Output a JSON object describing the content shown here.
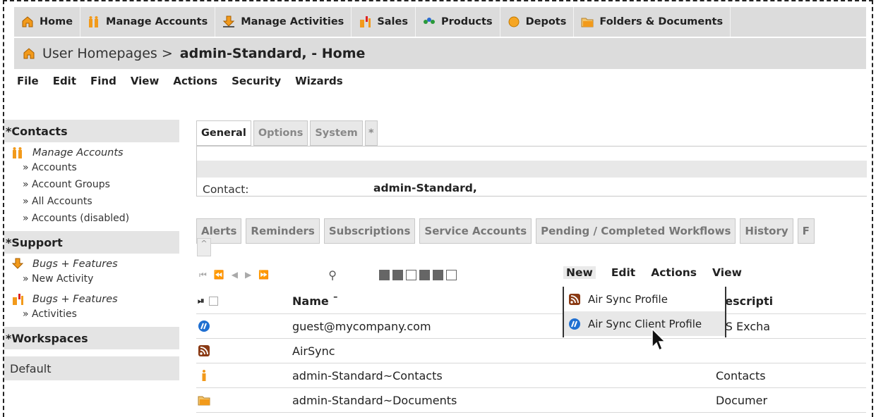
{
  "topnav": [
    {
      "label": "Home",
      "icon": "home-icon"
    },
    {
      "label": "Manage Accounts",
      "icon": "accounts-icon"
    },
    {
      "label": "Manage Activities",
      "icon": "activities-icon"
    },
    {
      "label": "Sales",
      "icon": "sales-icon"
    },
    {
      "label": "Products",
      "icon": "products-icon"
    },
    {
      "label": "Depots",
      "icon": "depots-icon"
    },
    {
      "label": "Folders & Documents",
      "icon": "folders-icon"
    }
  ],
  "breadcrumb": {
    "prefix": "User Homepages >",
    "current": "admin-Standard, - Home"
  },
  "menubar": [
    "File",
    "Edit",
    "Find",
    "View",
    "Actions",
    "Security",
    "Wizards"
  ],
  "sidebar": {
    "contacts": {
      "title": "*Contacts",
      "group_title": "Manage Accounts",
      "links": [
        "» Accounts",
        "» Account Groups",
        "» All Accounts",
        "» Accounts (disabled)"
      ]
    },
    "support": {
      "title": "*Support",
      "group1_title": "Bugs + Features",
      "group1_links": [
        "» New Activity"
      ],
      "group2_title": "Bugs + Features",
      "group2_links": [
        "» Activities"
      ]
    },
    "workspaces": {
      "title": "*Workspaces",
      "default": "Default"
    }
  },
  "tabs1": [
    "General",
    "Options",
    "System",
    "*"
  ],
  "contact": {
    "label": "Contact:",
    "value": "admin-Standard,"
  },
  "tabs2": [
    "Alerts",
    "Reminders",
    "Subscriptions",
    "Service Accounts",
    "Pending / Completed Workflows",
    "History",
    "F"
  ],
  "caret": "^",
  "gridmenu": [
    "New",
    "Edit",
    "Actions",
    "View"
  ],
  "table": {
    "col_name": "Name",
    "col_desc": "Descripti",
    "rows": [
      {
        "name": "guest@mycompany.com",
        "desc": "MS Excha",
        "icon": "airsync-client-icon"
      },
      {
        "name": "AirSync",
        "desc": "",
        "icon": "rss-icon"
      },
      {
        "name": "admin-Standard~Contacts",
        "desc": "Contacts",
        "icon": "contact-icon"
      },
      {
        "name": "admin-Standard~Documents",
        "desc": "Documer",
        "icon": "documents-icon"
      }
    ]
  },
  "dropdown": [
    {
      "label": "Air Sync Profile",
      "icon": "rss-icon"
    },
    {
      "label": "Air Sync Client Profile",
      "icon": "airsync-client-icon"
    }
  ],
  "colors": {
    "bar": "#dcdcdc",
    "orange": "#f29a1b",
    "blue": "#1f6fd1"
  }
}
